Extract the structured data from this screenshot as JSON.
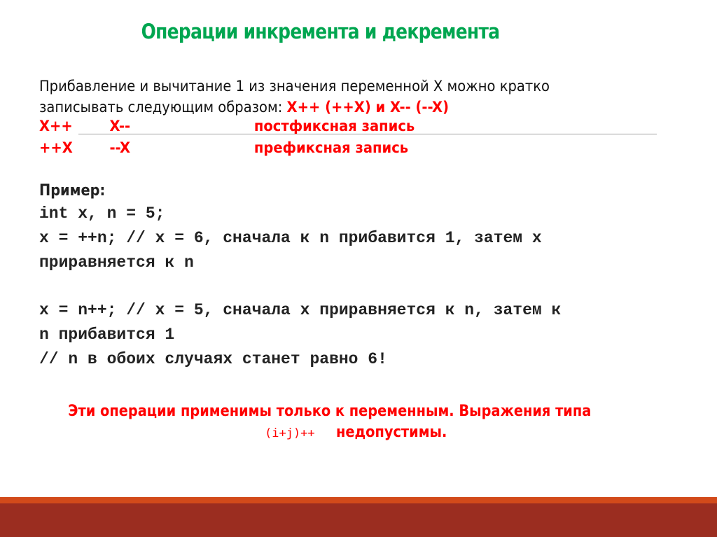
{
  "slide": {
    "title": "Операции инкремента и декремента",
    "intro": {
      "line1": "Прибавление и вычитание 1 из значения переменной X можно кратко",
      "line2_prefix": "записывать следующим образом: ",
      "line2_highlight": "X++ (++X) и X-- (--X)"
    },
    "notation_rows": [
      {
        "inc": "X++",
        "dec": "X--",
        "label": "постфиксная запись"
      },
      {
        "inc": "++X",
        "dec": "--X",
        "label": "префиксная запись"
      }
    ],
    "example": {
      "label": "Пример:",
      "code_lines": [
        "int x, n = 5;",
        "x = ++n; // x = 6, сначала к n прибавится 1, затем x",
        "приравняется к n",
        "x = n++; // x = 5, сначала x приравняется к n, затем к",
        "n прибавится 1",
        "// n в обоих случаях станет равно 6!"
      ]
    },
    "note": {
      "line1": "Эти операции применимы только к переменным. Выражения типа",
      "code": "(i+j)++",
      "line2": "недопустимы."
    },
    "colors": {
      "title": "#00a650",
      "highlight": "#ff0000",
      "footer_stripe": "#d24a1a",
      "footer_band": "#9b2d20"
    }
  }
}
